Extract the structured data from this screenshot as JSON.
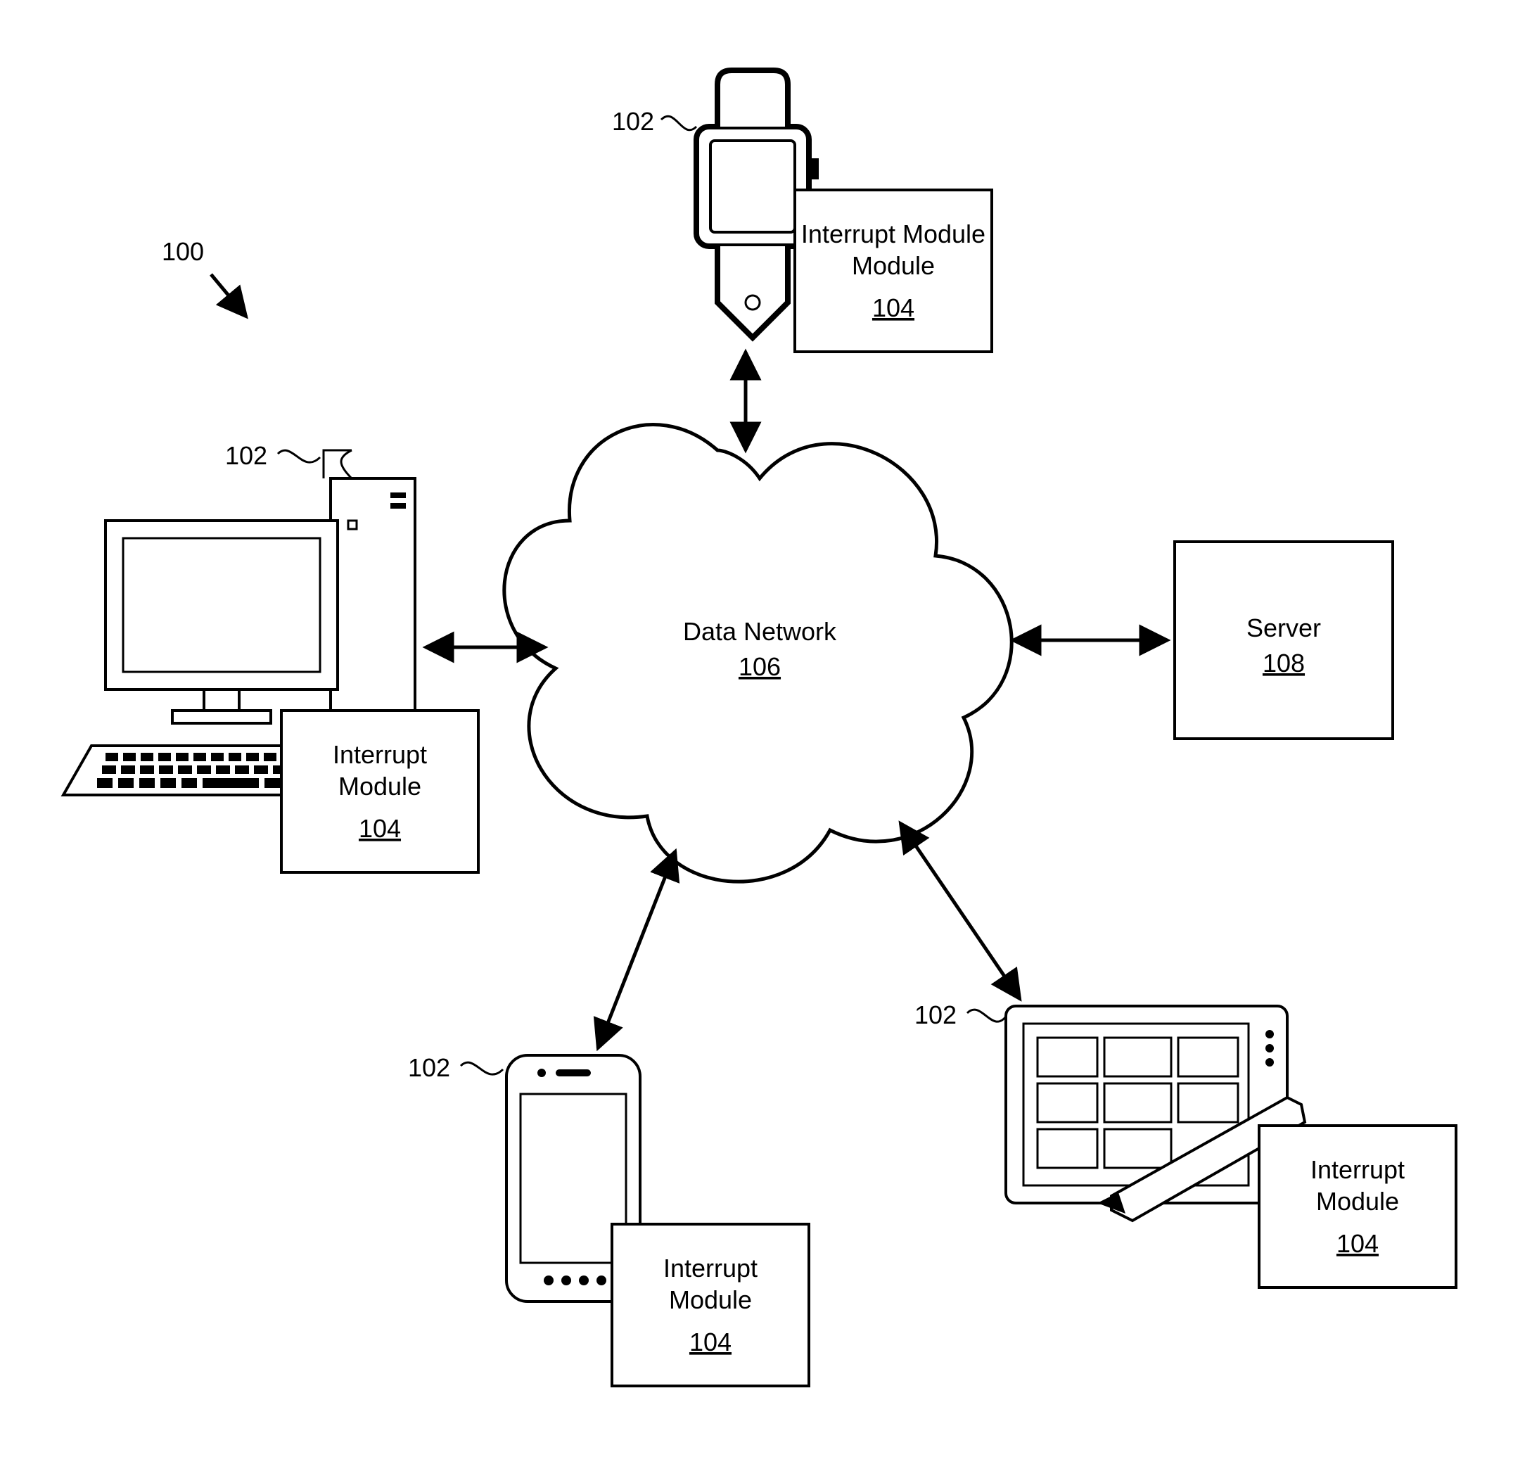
{
  "diagram": {
    "system_ref": "100",
    "cloud": {
      "title": "Data Network",
      "ref": "106"
    },
    "server": {
      "title": "Server",
      "ref": "108"
    },
    "devices": {
      "watch": {
        "ref": "102",
        "module_title": "Interrupt Module",
        "module_ref": "104"
      },
      "desktop": {
        "ref": "102",
        "module_title": "Interrupt Module",
        "module_ref": "104"
      },
      "phone": {
        "ref": "102",
        "module_title": "Interrupt Module",
        "module_ref": "104"
      },
      "tablet": {
        "ref": "102",
        "module_title": "Interrupt Module",
        "module_ref": "104"
      }
    }
  }
}
